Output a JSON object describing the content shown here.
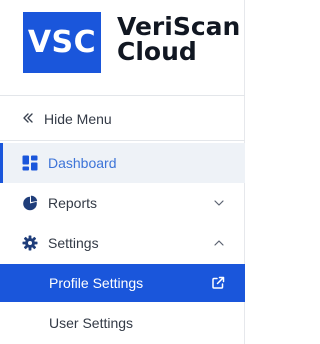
{
  "brand": {
    "logo_text": "VSC",
    "name_line1": "VeriScan",
    "name_line2": "Cloud",
    "accent_color": "#1a56db"
  },
  "hide_menu": {
    "label": "Hide Menu",
    "icon": "double-chevron-left-icon"
  },
  "nav": {
    "items": [
      {
        "label": "Dashboard",
        "icon": "dashboard-icon",
        "active": true
      },
      {
        "label": "Reports",
        "icon": "pie-chart-icon",
        "expanded": false
      },
      {
        "label": "Settings",
        "icon": "gear-icon",
        "expanded": true
      }
    ],
    "settings_sub": [
      {
        "label": "Profile Settings",
        "selected": true,
        "icon": "external-link-icon"
      },
      {
        "label": "User Settings",
        "selected": false
      }
    ]
  }
}
